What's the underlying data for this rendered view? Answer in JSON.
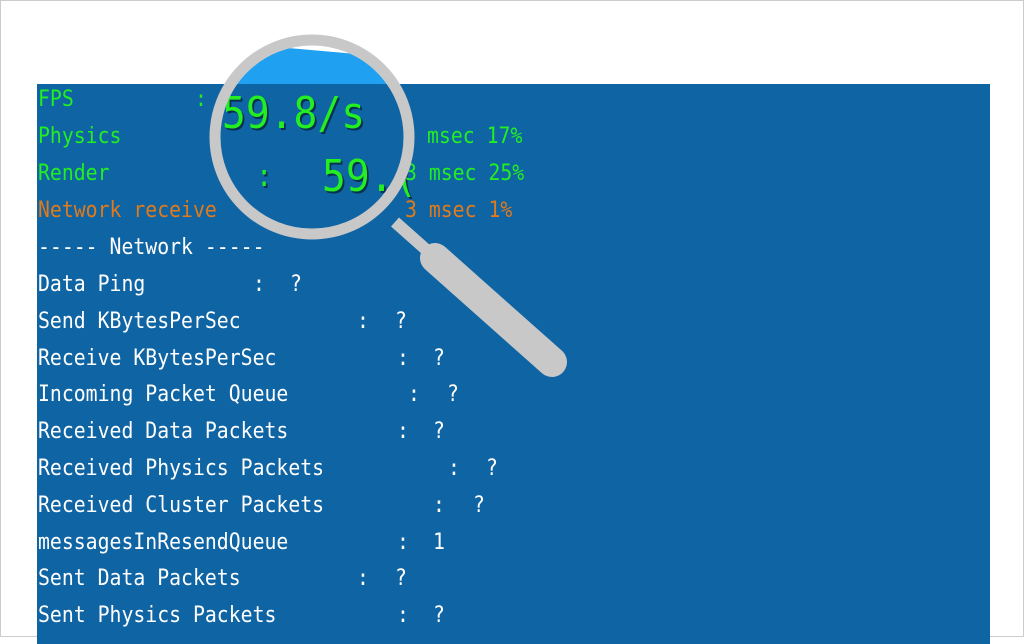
{
  "stats": {
    "fps": {
      "label": "FPS",
      "value": "59.8/s"
    },
    "physics": {
      "label": "Physics",
      "value": "msec 17%"
    },
    "render": {
      "label": "Render",
      "value_big": "59.(",
      "value": "3 msec 25%"
    },
    "network_receive": {
      "label": "Network receive",
      "value": "3 msec 1%"
    }
  },
  "section_header": "----- Network -----",
  "network": [
    {
      "label": "Data Ping",
      "value": "?"
    },
    {
      "label": "Send KBytesPerSec",
      "value": "?"
    },
    {
      "label": "Receive KBytesPerSec",
      "value": "?"
    },
    {
      "label": "Incoming Packet Queue",
      "value": "?"
    },
    {
      "label": "Received Data Packets",
      "value": "?"
    },
    {
      "label": "Received Physics Packets",
      "value": "?"
    },
    {
      "label": "Received Cluster Packets",
      "value": "?"
    },
    {
      "label": "messagesInResendQueue",
      "value": "1"
    },
    {
      "label": "Sent Data Packets",
      "value": "?"
    },
    {
      "label": "Sent Physics Packets",
      "value": "?"
    }
  ],
  "colors": {
    "panel": "#0f64a4",
    "ok": "#22ee22",
    "warn": "#e07a1a",
    "lens": "#c8c8c8"
  },
  "icons": {
    "magnifier": "magnifying-glass-icon"
  },
  "colon": ":"
}
